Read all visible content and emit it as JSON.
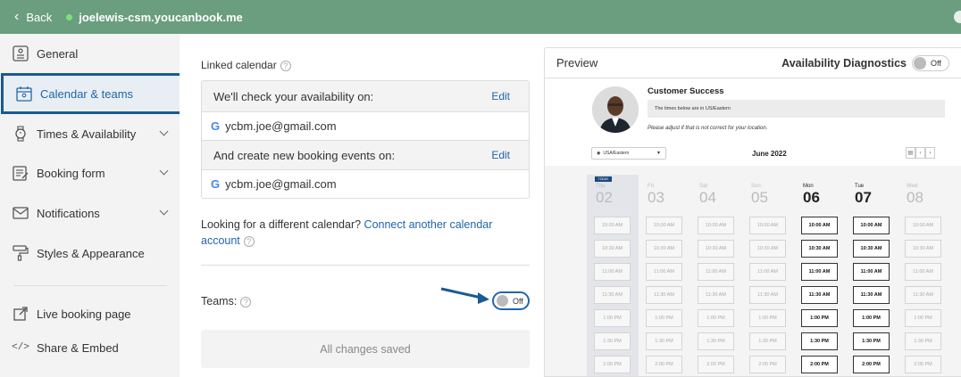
{
  "topbar": {
    "back": "Back",
    "site": "joelewis-csm.youcanbook.me"
  },
  "sidebar": {
    "items": [
      {
        "label": "General",
        "icon": "general-icon"
      },
      {
        "label": "Calendar & teams",
        "icon": "calendar-icon"
      },
      {
        "label": "Times & Availability",
        "icon": "watch-icon"
      },
      {
        "label": "Booking form",
        "icon": "form-icon"
      },
      {
        "label": "Notifications",
        "icon": "envelope-icon"
      },
      {
        "label": "Styles & Appearance",
        "icon": "paint-roller-icon"
      },
      {
        "label": "Live booking page",
        "icon": "external-link-icon"
      },
      {
        "label": "Share & Embed",
        "icon": "code-icon"
      }
    ]
  },
  "linked": {
    "title": "Linked calendar",
    "check_label": "We'll check your availability on:",
    "check_email": "ycbm.joe@gmail.com",
    "create_label": "And create new booking events on:",
    "create_email": "ycbm.joe@gmail.com",
    "edit": "Edit",
    "google": "G"
  },
  "lookfor": {
    "text": "Looking for a different calendar? ",
    "link": "Connect another calendar account"
  },
  "teams": {
    "label": "Teams:",
    "toggle": "Off"
  },
  "saved": "All changes saved",
  "preview": {
    "title": "Preview",
    "diagnostics": "Availability Diagnostics",
    "diag_toggle": "Off",
    "cs_title": "Customer Success",
    "tz_note": "The times below are in US/Eastern",
    "adjust_note": "Please adjust if that is not correct for your location.",
    "tz": "USA/Eastern",
    "month": "June 2022",
    "today": "TODAY",
    "days": [
      {
        "name": "Thu",
        "num": "02",
        "on": false
      },
      {
        "name": "Fri",
        "num": "03",
        "on": false
      },
      {
        "name": "Sat",
        "num": "04",
        "on": false
      },
      {
        "name": "Sun",
        "num": "05",
        "on": false
      },
      {
        "name": "Mon",
        "num": "06",
        "on": true
      },
      {
        "name": "Tue",
        "num": "07",
        "on": true
      },
      {
        "name": "Wed",
        "num": "08",
        "on": false
      }
    ],
    "times": [
      "10:00 AM",
      "10:30 AM",
      "11:00 AM",
      "11:30 AM",
      "1:00 PM",
      "1:30 PM",
      "2:00 PM"
    ]
  },
  "colors": {
    "topbar": "#6a9e7f",
    "accent": "#2266a8",
    "active_border": "#1a5a93"
  }
}
